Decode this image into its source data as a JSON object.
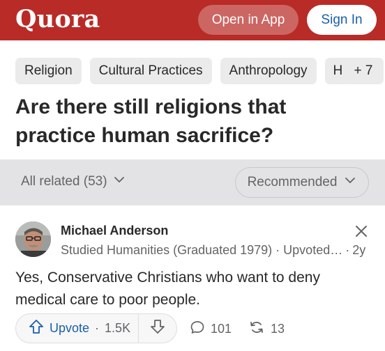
{
  "header": {
    "logo": "Quora",
    "open_in_app": "Open in App",
    "sign_in": "Sign In",
    "brand_color": "#b92b27"
  },
  "topics": [
    "Religion",
    "Cultural Practices",
    "Anthropology",
    "H"
  ],
  "topics_more": "+ 7",
  "question": {
    "title": "Are there still religions that practice human sacrifice?"
  },
  "filters": {
    "all_related": "All related (53)",
    "sort": "Recommended"
  },
  "answer": {
    "author": "Michael Anderson",
    "credential": "Studied Humanities (Graduated 1979) · Upvoted…",
    "age": "2y",
    "text": "Yes, Conservative Christians who want to deny medical care to poor people.",
    "upvote_label": "Upvote",
    "upvote_sep": "·",
    "upvotes": "1.5K",
    "comments": "101",
    "shares": "13"
  },
  "icons": [
    "chevron-down-icon",
    "close-icon",
    "upvote-arrow-icon",
    "downvote-arrow-icon",
    "comment-icon",
    "share-icon"
  ]
}
